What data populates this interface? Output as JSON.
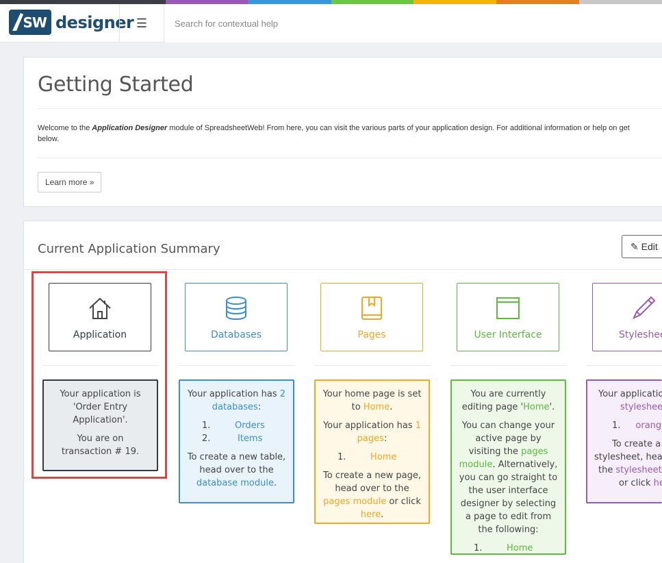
{
  "brand": {
    "badge": "SW",
    "name": "designer"
  },
  "colorstrip": [
    "#3c3d44",
    "#9b59b6",
    "#3498db",
    "#6cc644",
    "#f5b400",
    "#e67e22",
    "#c8c8c8"
  ],
  "header": {
    "menu_icon": "☰",
    "search_placeholder": "Search for contextual help"
  },
  "getting_started": {
    "title": "Getting Started",
    "intro_prefix": "Welcome to the ",
    "intro_bold": "Application Designer",
    "intro_rest": " module of SpreadsheetWeb! From here, you can visit the various parts of your application design. For additional information or help on get",
    "intro_line2": "below.",
    "learn_more": "Learn more »"
  },
  "summary": {
    "title": "Current Application Summary",
    "edit_icon": "✎",
    "edit_label": "Edit",
    "tiles": [
      {
        "label": "Application",
        "icon": "home-icon",
        "color": "#333a44"
      },
      {
        "label": "Databases",
        "icon": "database-icon",
        "color": "#3b8fd1"
      },
      {
        "label": "Pages",
        "icon": "book-icon",
        "color": "#f5a623"
      },
      {
        "label": "User Interface",
        "icon": "browser-window-icon",
        "color": "#5bbb3a"
      },
      {
        "label": "Stylesheets",
        "icon": "brush-icon",
        "color": "#9b59b6"
      }
    ],
    "application": {
      "line1": "Your application is 'Order Entry Application'.",
      "line2": "You are on transaction # 19."
    },
    "databases": {
      "pre": "Your application has ",
      "count": "2",
      "link": "databases",
      "post": ":",
      "items": [
        "Orders",
        "Items"
      ],
      "create_pre": "To create a new table, head over to the ",
      "create_link": "database module",
      "create_post": "."
    },
    "pages": {
      "home_pre": "Your home page is set to ",
      "home_link": "Home",
      "home_post": ".",
      "has_pre": "Your application has ",
      "count": "1",
      "link": "pages",
      "post": ":",
      "items": [
        "Home"
      ],
      "create_pre": "To create a new page, head over to the ",
      "create_link": "pages module",
      "create_mid": " or click ",
      "create_link2": "here",
      "create_post": "."
    },
    "ui": {
      "edit_pre": "You are currently editing page '",
      "edit_link": "Home",
      "edit_post": "'.",
      "change_pre": "You can change your active page by visiting the ",
      "change_link": "pages module",
      "change_post": ". Alternatively, you can go straight to the user interface designer by selecting a page to edit from the following:",
      "items": [
        "Home"
      ]
    },
    "stylesheets": {
      "pre": "Your application",
      "link": "stylesheets",
      "items": [
        "orange"
      ],
      "create_pre": "To create a n",
      "create_mid": "stylesheet, head",
      "create_the": "the ",
      "create_link": "stylesheets n",
      "create_or": "or click ",
      "create_link2": "her"
    }
  }
}
